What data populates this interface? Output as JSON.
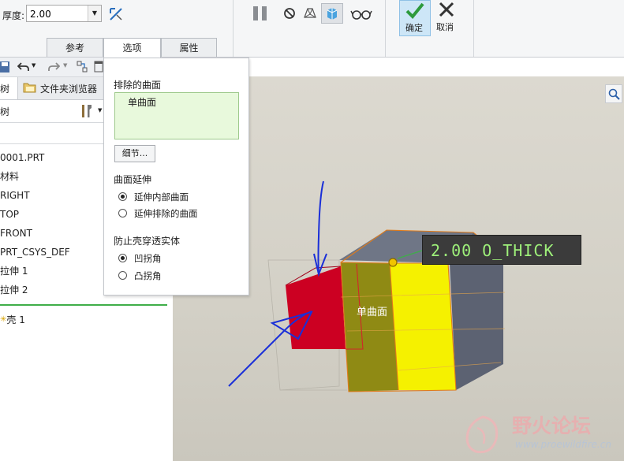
{
  "ribbon": {
    "thickness_label": "厚度:",
    "thickness_value": "2.00",
    "tabs": [
      "参考",
      "选项",
      "属性"
    ],
    "ok_label": "确定",
    "cancel_label": "取消"
  },
  "left_panel": {
    "tabs": [
      "树",
      "文件夹浏览器"
    ],
    "tree_header": "树",
    "items": [
      "0001.PRT",
      "材料",
      "RIGHT",
      "TOP",
      "FRONT",
      "PRT_CSYS_DEF",
      "拉伸 1",
      "拉伸 2",
      "壳 1"
    ]
  },
  "options": {
    "excluded_label": "排除的曲面",
    "excluded_item": "单曲面",
    "details_button": "细节...",
    "extend_label": "曲面延伸",
    "extend_options": [
      "延伸内部曲面",
      "延伸排除的曲面"
    ],
    "extend_selected": 0,
    "prevent_label": "防止壳穿透实体",
    "prevent_options": [
      "凹拐角",
      "凸拐角"
    ],
    "prevent_selected": 0
  },
  "viewport": {
    "dimension_tag": "2.00 O_THICK",
    "surface_label": "单曲面"
  },
  "watermark": {
    "name": "野火论坛",
    "url": "www.proewildfire.cn"
  },
  "colors": {
    "accent": "#3fae49",
    "selected_face": "#f5f100",
    "red_block": "#cc0022",
    "excluded_bg": "#e8f9dc"
  }
}
